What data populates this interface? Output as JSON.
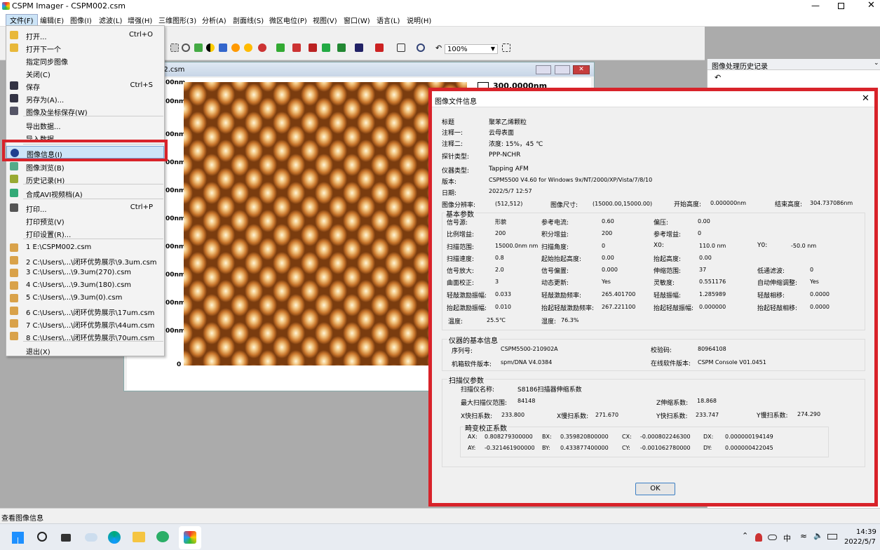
{
  "app": {
    "title": "CSPM Imager - CSPM002.csm",
    "window_controls": [
      "minimize-icon",
      "maximize-icon",
      "close-icon"
    ]
  },
  "menubar": [
    "文件(F)",
    "编辑(E)",
    "图像(I)",
    "滤波(L)",
    "增强(H)",
    "三维图形(3)",
    "分析(A)",
    "剖面线(S)",
    "微区电位(P)",
    "视图(V)",
    "窗口(W)",
    "语言(L)",
    "说明(H)"
  ],
  "toolbar": {
    "zoom": "100%"
  },
  "child_window": {
    "title": "02.csm",
    "y_ticks": [
      "00nm",
      "00nm",
      "00nm",
      "00nm",
      "00nm",
      "00nm",
      "00nm",
      "00nm",
      "00nm",
      "00nm",
      "0"
    ],
    "scale_label": "300.0000nm"
  },
  "file_menu": [
    {
      "label": "打开...",
      "shortcut": "Ctrl+O",
      "icon": "open-folder-icon"
    },
    {
      "label": "打开下一个",
      "shortcut": "",
      "icon": "open-next-icon"
    },
    {
      "label": "指定同步图像",
      "shortcut": "",
      "icon": ""
    },
    {
      "label": "关闭(C)",
      "shortcut": "",
      "icon": ""
    },
    {
      "label": "保存",
      "shortcut": "Ctrl+S",
      "icon": "save-icon"
    },
    {
      "label": "另存为(A)...",
      "shortcut": "",
      "icon": "save-as-icon"
    },
    {
      "label": "图像及坐标保存(W)",
      "shortcut": "",
      "icon": "save-image-icon"
    },
    {
      "label": "导出数据...",
      "shortcut": "",
      "icon": ""
    },
    {
      "label": "导入数据...",
      "shortcut": "",
      "icon": ""
    },
    {
      "label": "图像信息(I)",
      "shortcut": "",
      "icon": "info-icon"
    },
    {
      "label": "图像浏览(B)",
      "shortcut": "",
      "icon": "browse-icon"
    },
    {
      "label": "历史记录(H)",
      "shortcut": "",
      "icon": "history-icon"
    },
    {
      "label": "合成AVI视频档(A)",
      "shortcut": "",
      "icon": "video-icon"
    },
    {
      "label": "打印...",
      "shortcut": "Ctrl+P",
      "icon": "print-icon"
    },
    {
      "label": "打印预览(V)",
      "shortcut": "",
      "icon": ""
    },
    {
      "label": "打印设置(R)...",
      "shortcut": "",
      "icon": ""
    },
    {
      "label": "1 E:\\CSPM002.csm",
      "shortcut": "",
      "icon": "recent-file-icon"
    },
    {
      "label": "2 C:\\Users\\...\\闭环优势展示\\9.3um.csm",
      "shortcut": "",
      "icon": "recent-file-icon"
    },
    {
      "label": "3 C:\\Users\\...\\9.3um(270).csm",
      "shortcut": "",
      "icon": "recent-file-icon"
    },
    {
      "label": "4 C:\\Users\\...\\9.3um(180).csm",
      "shortcut": "",
      "icon": "recent-file-icon"
    },
    {
      "label": "5 C:\\Users\\...\\9.3um(0).csm",
      "shortcut": "",
      "icon": "recent-file-icon"
    },
    {
      "label": "6 C:\\Users\\...\\闭环优势展示\\17um.csm",
      "shortcut": "",
      "icon": "recent-file-icon"
    },
    {
      "label": "7 C:\\Users\\...\\闭环优势展示\\44um.csm",
      "shortcut": "",
      "icon": "recent-file-icon"
    },
    {
      "label": "8 C:\\Users\\...\\闭环优势展示\\70um.csm",
      "shortcut": "",
      "icon": "recent-file-icon"
    },
    {
      "label": "退出(X)",
      "shortcut": "",
      "icon": ""
    }
  ],
  "history_panel": {
    "title": "图像处理历史记录"
  },
  "dialog": {
    "title": "图像文件信息",
    "header_rows": [
      {
        "label": "标题",
        "value": "聚苯乙烯颗粒"
      },
      {
        "label": "注释一:",
        "value": "云母表面"
      },
      {
        "label": "注释二:",
        "value": "浓度: 15%，45 ℃"
      },
      {
        "label": "探针类型:",
        "value": "PPP-NCHR"
      },
      {
        "label": "仪器类型:",
        "value": "Tapping AFM"
      },
      {
        "label": "版本:",
        "value": "CSPM5500 V4.60 for Windows 9x/NT/2000/XP/Vista/7/8/10"
      },
      {
        "label": "日期:",
        "value": "2022/5/7 12:57"
      }
    ],
    "res_row": {
      "res_label": "图像分辨率:",
      "res_value": "(512,512)",
      "size_label": "图像尺寸:",
      "size_value": "(15000.00,15000.00)",
      "start_label": "开始高度:",
      "start_value": "0.000000nm",
      "end_label": "结束高度:",
      "end_value": "304.737086nm"
    },
    "basic": {
      "title": "基本参数",
      "rows": [
        [
          [
            "信号源:",
            "形貌"
          ],
          [
            "参考电流:",
            "0.60"
          ],
          [
            "偏压:",
            "0.00"
          ]
        ],
        [
          [
            "比例增益:",
            "200"
          ],
          [
            "积分增益:",
            "200"
          ],
          [
            "参考增益:",
            "0"
          ]
        ],
        [
          [
            "扫描范围:",
            "15000.0nm nm"
          ],
          [
            "扫描角度:",
            "0"
          ],
          [
            "X0:",
            "110.0 nm"
          ],
          [
            "Y0:",
            "-50.0 nm"
          ]
        ],
        [
          [
            "扫描速度:",
            "0.8"
          ],
          [
            "起始抬起高度:",
            "0.00"
          ],
          [
            "抬起高度:",
            "0.00"
          ]
        ],
        [
          [
            "信号放大:",
            "2.0"
          ],
          [
            "信号偏置:",
            "0.000"
          ],
          [
            "伸缩范围:",
            "37"
          ],
          [
            "低通滤波:",
            "0"
          ]
        ],
        [
          [
            "曲面校正:",
            "3"
          ],
          [
            "动态更新:",
            "Yes"
          ],
          [
            "灵敏度:",
            "0.551176"
          ],
          [
            "自动伸缩调整:",
            "Yes"
          ]
        ],
        [
          [
            "轻敲激励振幅:",
            "0.033"
          ],
          [
            "轻敲激励频率:",
            "265.401700"
          ],
          [
            "轻敲振幅:",
            "1.285989"
          ],
          [
            "轻敲相移:",
            "0.0000"
          ]
        ],
        [
          [
            "抬起激励振幅:",
            "0.010"
          ],
          [
            "抬起轻敲激励频率:",
            "267.221100"
          ],
          [
            "抬起轻敲振幅:",
            "0.000000"
          ],
          [
            "抬起轻敲相移:",
            "0.0000"
          ]
        ],
        [
          [
            "温度:",
            "25.5℃"
          ],
          [
            "湿度:",
            "76.3%"
          ]
        ]
      ]
    },
    "instrument": {
      "title": "仪器的基本信息",
      "serial_label": "序列号:",
      "serial": "CSPM5500-210902A",
      "check_label": "校验码:",
      "check": "80964108",
      "fw_label": "机箱软件版本:",
      "fw": "spm/DNA V4.0384",
      "online_label": "在线软件版本:",
      "online": "CSPM Console V01.0451"
    },
    "scanner": {
      "title": "扫描仪参数",
      "name_label": "扫描仪名称:",
      "name": "S8186扫描器伸缩系数",
      "max_label": "最大扫描仪范围:",
      "max": "84148",
      "z_label": "Z伸缩系数:",
      "z": "18.868",
      "xf_label": "X快扫系数:",
      "xf": "233.800",
      "xs_label": "X慢扫系数:",
      "xs": "271.670",
      "yf_label": "Y快扫系数:",
      "yf": "233.747",
      "ys_label": "Y慢扫系数:",
      "ys": "274.290",
      "distortion": {
        "title": "畸变校正系数",
        "rows": [
          [
            [
              "AX:",
              "0.808279300000"
            ],
            [
              "BX:",
              "0.359820800000"
            ],
            [
              "CX:",
              "-0.000802246300"
            ],
            [
              "DX:",
              "0.000000194149"
            ]
          ],
          [
            [
              "AY:",
              "-0.321461900000"
            ],
            [
              "BY:",
              "0.433877400000"
            ],
            [
              "CY:",
              "-0.001062780000"
            ],
            [
              "DY:",
              "0.000000422045"
            ]
          ]
        ]
      }
    },
    "ok_label": "OK"
  },
  "statusbar": {
    "text": "查看图像信息"
  },
  "taskbar": {
    "time": "14:39",
    "date": "2022/5/7",
    "ime": "中"
  }
}
